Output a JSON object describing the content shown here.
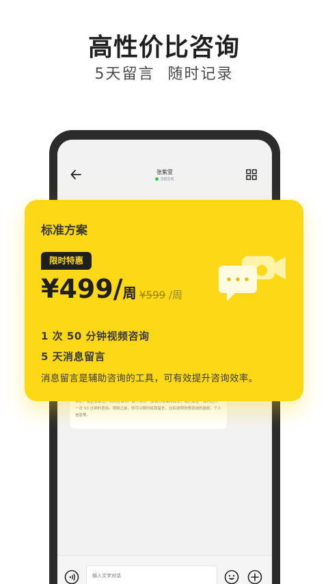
{
  "promo": {
    "headline": "高性价比咨询",
    "subline": "5天留言  随时记录"
  },
  "chat": {
    "contact_name": "张紫萱",
    "contact_status": "当前在线",
    "message_text": "你好，我是张紫萱，你的咨询师。接下来的一周我们将保持联系，我们会在一周内进行一次 50 分钟的咨询。视频之前，你可以随时给我留言，比如说明你想咨询的困扰、个人信息等。",
    "input_placeholder": "输入文字对话"
  },
  "plan": {
    "title": "标准方案",
    "badge": "限时特惠",
    "price": "¥499/",
    "price_unit": "周",
    "original_price": "¥599",
    "original_unit": " /周",
    "features": [
      "1 次 50 分钟视频咨询",
      "5 天消息留言"
    ],
    "description": "消息留言是辅助咨询的工具，可有效提升咨询效率。"
  },
  "colors": {
    "accent": "#fdd817",
    "dark": "#1f1f1f",
    "online": "#33c44a"
  },
  "icons": [
    "back-arrow-icon",
    "grid-icon",
    "video-chat-icon",
    "voice-icon",
    "emoji-icon",
    "plus-icon"
  ]
}
